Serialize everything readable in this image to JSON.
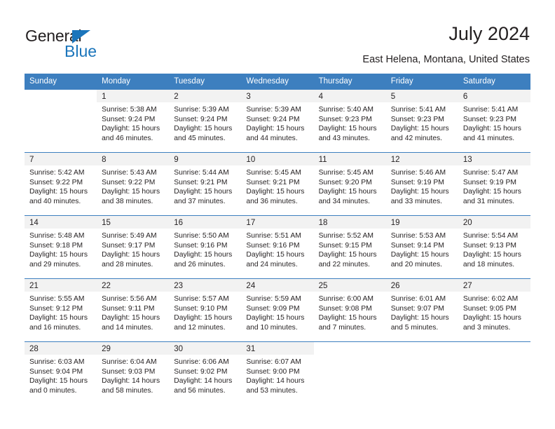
{
  "brand": {
    "name_part1": "General",
    "name_part2": "Blue",
    "triangle_color": "#1b75bb"
  },
  "header": {
    "title": "July 2024",
    "subtitle": "East Helena, Montana, United States",
    "header_bg": "#3d7fbf",
    "daynum_bg": "#f2f2f2"
  },
  "weekdays": [
    "Sunday",
    "Monday",
    "Tuesday",
    "Wednesday",
    "Thursday",
    "Friday",
    "Saturday"
  ],
  "labels": {
    "sunrise": "Sunrise:",
    "sunset": "Sunset:",
    "daylight": "Daylight:"
  },
  "weeks": [
    [
      {
        "day": "",
        "empty": true
      },
      {
        "day": "1",
        "sunrise": "Sunrise: 5:38 AM",
        "sunset": "Sunset: 9:24 PM",
        "daylight1": "Daylight: 15 hours",
        "daylight2": "and 46 minutes."
      },
      {
        "day": "2",
        "sunrise": "Sunrise: 5:39 AM",
        "sunset": "Sunset: 9:24 PM",
        "daylight1": "Daylight: 15 hours",
        "daylight2": "and 45 minutes."
      },
      {
        "day": "3",
        "sunrise": "Sunrise: 5:39 AM",
        "sunset": "Sunset: 9:24 PM",
        "daylight1": "Daylight: 15 hours",
        "daylight2": "and 44 minutes."
      },
      {
        "day": "4",
        "sunrise": "Sunrise: 5:40 AM",
        "sunset": "Sunset: 9:23 PM",
        "daylight1": "Daylight: 15 hours",
        "daylight2": "and 43 minutes."
      },
      {
        "day": "5",
        "sunrise": "Sunrise: 5:41 AM",
        "sunset": "Sunset: 9:23 PM",
        "daylight1": "Daylight: 15 hours",
        "daylight2": "and 42 minutes."
      },
      {
        "day": "6",
        "sunrise": "Sunrise: 5:41 AM",
        "sunset": "Sunset: 9:23 PM",
        "daylight1": "Daylight: 15 hours",
        "daylight2": "and 41 minutes."
      }
    ],
    [
      {
        "day": "7",
        "sunrise": "Sunrise: 5:42 AM",
        "sunset": "Sunset: 9:22 PM",
        "daylight1": "Daylight: 15 hours",
        "daylight2": "and 40 minutes."
      },
      {
        "day": "8",
        "sunrise": "Sunrise: 5:43 AM",
        "sunset": "Sunset: 9:22 PM",
        "daylight1": "Daylight: 15 hours",
        "daylight2": "and 38 minutes."
      },
      {
        "day": "9",
        "sunrise": "Sunrise: 5:44 AM",
        "sunset": "Sunset: 9:21 PM",
        "daylight1": "Daylight: 15 hours",
        "daylight2": "and 37 minutes."
      },
      {
        "day": "10",
        "sunrise": "Sunrise: 5:45 AM",
        "sunset": "Sunset: 9:21 PM",
        "daylight1": "Daylight: 15 hours",
        "daylight2": "and 36 minutes."
      },
      {
        "day": "11",
        "sunrise": "Sunrise: 5:45 AM",
        "sunset": "Sunset: 9:20 PM",
        "daylight1": "Daylight: 15 hours",
        "daylight2": "and 34 minutes."
      },
      {
        "day": "12",
        "sunrise": "Sunrise: 5:46 AM",
        "sunset": "Sunset: 9:19 PM",
        "daylight1": "Daylight: 15 hours",
        "daylight2": "and 33 minutes."
      },
      {
        "day": "13",
        "sunrise": "Sunrise: 5:47 AM",
        "sunset": "Sunset: 9:19 PM",
        "daylight1": "Daylight: 15 hours",
        "daylight2": "and 31 minutes."
      }
    ],
    [
      {
        "day": "14",
        "sunrise": "Sunrise: 5:48 AM",
        "sunset": "Sunset: 9:18 PM",
        "daylight1": "Daylight: 15 hours",
        "daylight2": "and 29 minutes."
      },
      {
        "day": "15",
        "sunrise": "Sunrise: 5:49 AM",
        "sunset": "Sunset: 9:17 PM",
        "daylight1": "Daylight: 15 hours",
        "daylight2": "and 28 minutes."
      },
      {
        "day": "16",
        "sunrise": "Sunrise: 5:50 AM",
        "sunset": "Sunset: 9:16 PM",
        "daylight1": "Daylight: 15 hours",
        "daylight2": "and 26 minutes."
      },
      {
        "day": "17",
        "sunrise": "Sunrise: 5:51 AM",
        "sunset": "Sunset: 9:16 PM",
        "daylight1": "Daylight: 15 hours",
        "daylight2": "and 24 minutes."
      },
      {
        "day": "18",
        "sunrise": "Sunrise: 5:52 AM",
        "sunset": "Sunset: 9:15 PM",
        "daylight1": "Daylight: 15 hours",
        "daylight2": "and 22 minutes."
      },
      {
        "day": "19",
        "sunrise": "Sunrise: 5:53 AM",
        "sunset": "Sunset: 9:14 PM",
        "daylight1": "Daylight: 15 hours",
        "daylight2": "and 20 minutes."
      },
      {
        "day": "20",
        "sunrise": "Sunrise: 5:54 AM",
        "sunset": "Sunset: 9:13 PM",
        "daylight1": "Daylight: 15 hours",
        "daylight2": "and 18 minutes."
      }
    ],
    [
      {
        "day": "21",
        "sunrise": "Sunrise: 5:55 AM",
        "sunset": "Sunset: 9:12 PM",
        "daylight1": "Daylight: 15 hours",
        "daylight2": "and 16 minutes."
      },
      {
        "day": "22",
        "sunrise": "Sunrise: 5:56 AM",
        "sunset": "Sunset: 9:11 PM",
        "daylight1": "Daylight: 15 hours",
        "daylight2": "and 14 minutes."
      },
      {
        "day": "23",
        "sunrise": "Sunrise: 5:57 AM",
        "sunset": "Sunset: 9:10 PM",
        "daylight1": "Daylight: 15 hours",
        "daylight2": "and 12 minutes."
      },
      {
        "day": "24",
        "sunrise": "Sunrise: 5:59 AM",
        "sunset": "Sunset: 9:09 PM",
        "daylight1": "Daylight: 15 hours",
        "daylight2": "and 10 minutes."
      },
      {
        "day": "25",
        "sunrise": "Sunrise: 6:00 AM",
        "sunset": "Sunset: 9:08 PM",
        "daylight1": "Daylight: 15 hours",
        "daylight2": "and 7 minutes."
      },
      {
        "day": "26",
        "sunrise": "Sunrise: 6:01 AM",
        "sunset": "Sunset: 9:07 PM",
        "daylight1": "Daylight: 15 hours",
        "daylight2": "and 5 minutes."
      },
      {
        "day": "27",
        "sunrise": "Sunrise: 6:02 AM",
        "sunset": "Sunset: 9:05 PM",
        "daylight1": "Daylight: 15 hours",
        "daylight2": "and 3 minutes."
      }
    ],
    [
      {
        "day": "28",
        "sunrise": "Sunrise: 6:03 AM",
        "sunset": "Sunset: 9:04 PM",
        "daylight1": "Daylight: 15 hours",
        "daylight2": "and 0 minutes."
      },
      {
        "day": "29",
        "sunrise": "Sunrise: 6:04 AM",
        "sunset": "Sunset: 9:03 PM",
        "daylight1": "Daylight: 14 hours",
        "daylight2": "and 58 minutes."
      },
      {
        "day": "30",
        "sunrise": "Sunrise: 6:06 AM",
        "sunset": "Sunset: 9:02 PM",
        "daylight1": "Daylight: 14 hours",
        "daylight2": "and 56 minutes."
      },
      {
        "day": "31",
        "sunrise": "Sunrise: 6:07 AM",
        "sunset": "Sunset: 9:00 PM",
        "daylight1": "Daylight: 14 hours",
        "daylight2": "and 53 minutes."
      },
      {
        "day": "",
        "empty": true
      },
      {
        "day": "",
        "empty": true
      },
      {
        "day": "",
        "empty": true
      }
    ]
  ]
}
